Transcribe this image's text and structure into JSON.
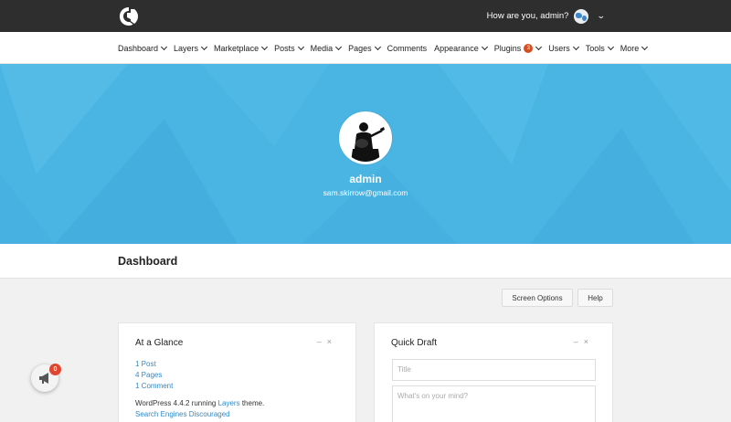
{
  "topbar": {
    "logo": "layers-logo",
    "greeting": "How are you, admin?",
    "avatar_icon": "globe-icon"
  },
  "menu": {
    "items": [
      {
        "label": "Dashboard",
        "has_chevron": true
      },
      {
        "label": "Layers",
        "has_chevron": true
      },
      {
        "label": "Marketplace",
        "has_chevron": true
      },
      {
        "label": "Posts",
        "has_chevron": true
      },
      {
        "label": "Media",
        "has_chevron": true
      },
      {
        "label": "Pages",
        "has_chevron": true
      },
      {
        "label": "Comments",
        "has_chevron": false
      },
      {
        "label": "Appearance",
        "has_chevron": true
      },
      {
        "label": "Plugins",
        "has_chevron": true,
        "badge": "3"
      },
      {
        "label": "Users",
        "has_chevron": true
      },
      {
        "label": "Tools",
        "has_chevron": true
      },
      {
        "label": "More",
        "has_chevron": true
      }
    ]
  },
  "profile": {
    "name": "admin",
    "email": "sam.skirrow@gmail.com"
  },
  "page": {
    "title": "Dashboard",
    "screen_options": "Screen Options",
    "help": "Help"
  },
  "glance": {
    "title": "At a Glance",
    "posts": "1 Post",
    "pages": "4 Pages",
    "comments": "1 Comment",
    "running_prefix": "WordPress 4.4.2 running ",
    "theme_link": "Layers",
    "running_suffix": " theme.",
    "search_engines": "Search Engines Discouraged"
  },
  "quick_draft": {
    "title": "Quick Draft",
    "title_placeholder": "Title",
    "content_placeholder": "What's on your mind?"
  },
  "notification": {
    "count": "0",
    "icon": "megaphone-icon"
  },
  "colors": {
    "topbar": "#2e2e2e",
    "hero": "#4ab5e3",
    "link": "#2f8ac9",
    "badge": "#d54e21"
  }
}
